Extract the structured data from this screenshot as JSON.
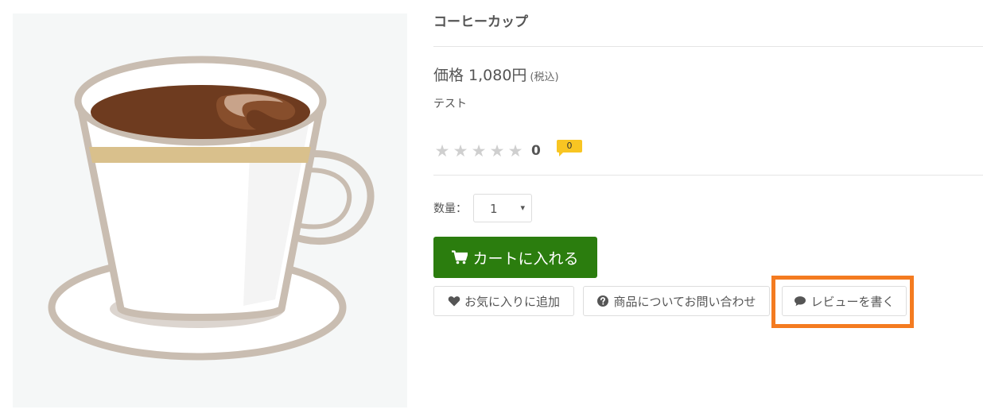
{
  "product": {
    "title": "コーヒーカップ",
    "price_label": "価格",
    "price_value": "1,080円",
    "tax_note": "(税込)",
    "description": "テスト",
    "image_icon": "coffee-cup-illustration"
  },
  "rating": {
    "stars_filled": 0,
    "stars_total": 5,
    "star_glyph": "★",
    "value": "0",
    "review_count": "0",
    "badge_color": "#f8c522"
  },
  "quantity": {
    "label": "数量：",
    "selected": "1",
    "caret": "▾"
  },
  "cart_button": {
    "label": "カートに入れる",
    "icon": "cart-icon",
    "color": "#2b7d0e"
  },
  "actions": {
    "favorite_label": "お気に入りに追加",
    "favorite_icon": "heart-icon",
    "contact_label": "商品についてお問い合わせ",
    "contact_icon": "question-circle-icon",
    "review_label": "レビューを書く",
    "review_icon": "comment-icon"
  },
  "highlight": {
    "color": "#f47b20"
  }
}
